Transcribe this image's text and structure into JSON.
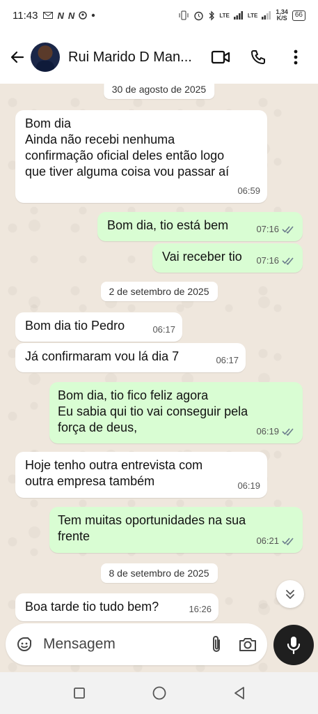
{
  "status_bar": {
    "time": "11:43",
    "left_icons": [
      "email-icon",
      "netflix-icon",
      "netflix-icon",
      "pinterest-icon",
      "dot-icon"
    ],
    "network_speed_value": "1,34",
    "network_speed_unit": "K/S",
    "lte1": "LTE",
    "lte2": "LTE",
    "battery": "66"
  },
  "header": {
    "contact_name": "Rui Marido D Man...",
    "actions": [
      "video-call-icon",
      "phone-icon",
      "more-vert-icon"
    ]
  },
  "messages": [
    {
      "type": "date",
      "text": "30 de agosto de 2025"
    },
    {
      "type": "in",
      "text": "Bom dia\nAinda não recebi nenhuma\nconfirmação oficial deles então logo\nque tiver alguma coisa vou passar aí",
      "time": "06:59"
    },
    {
      "type": "out",
      "text": "Bom dia, tio está bem",
      "time": "07:16",
      "status": "read"
    },
    {
      "type": "out",
      "text": "Vai receber tio",
      "time": "07:16",
      "status": "read"
    },
    {
      "type": "date",
      "text": "2 de setembro de 2025"
    },
    {
      "type": "in",
      "text": "Bom dia tio Pedro",
      "time": "06:17"
    },
    {
      "type": "in",
      "text": "Já confirmaram vou lá dia 7",
      "time": "06:17"
    },
    {
      "type": "out",
      "text": "Bom dia, tio fico feliz agora\nEu sabia qui tio vai conseguir pela\nforça de deus,",
      "time": "06:19",
      "status": "read"
    },
    {
      "type": "in",
      "text": "Hoje tenho outra entrevista com\noutra empresa também",
      "time": "06:19"
    },
    {
      "type": "out",
      "text": "Tem muitas oportunidades na sua\nfrente",
      "time": "06:21",
      "status": "read"
    },
    {
      "type": "date",
      "text": "8 de setembro de 2025"
    },
    {
      "type": "in",
      "text": "Boa tarde tio tudo bem?",
      "time": "16:26"
    }
  ],
  "input": {
    "placeholder": "Mensagem",
    "icons": [
      "sticker-icon",
      "attach-icon",
      "camera-icon",
      "mic-icon"
    ]
  },
  "nav_bar": [
    "recents-square-icon",
    "home-circle-icon",
    "back-triangle-icon"
  ],
  "colors": {
    "chat_background": "#efe7dd",
    "incoming_bubble": "#ffffff",
    "outgoing_bubble": "#d9fdd3",
    "read_ticks": "#6b7b8c",
    "mic_button": "#1f1f1f"
  }
}
